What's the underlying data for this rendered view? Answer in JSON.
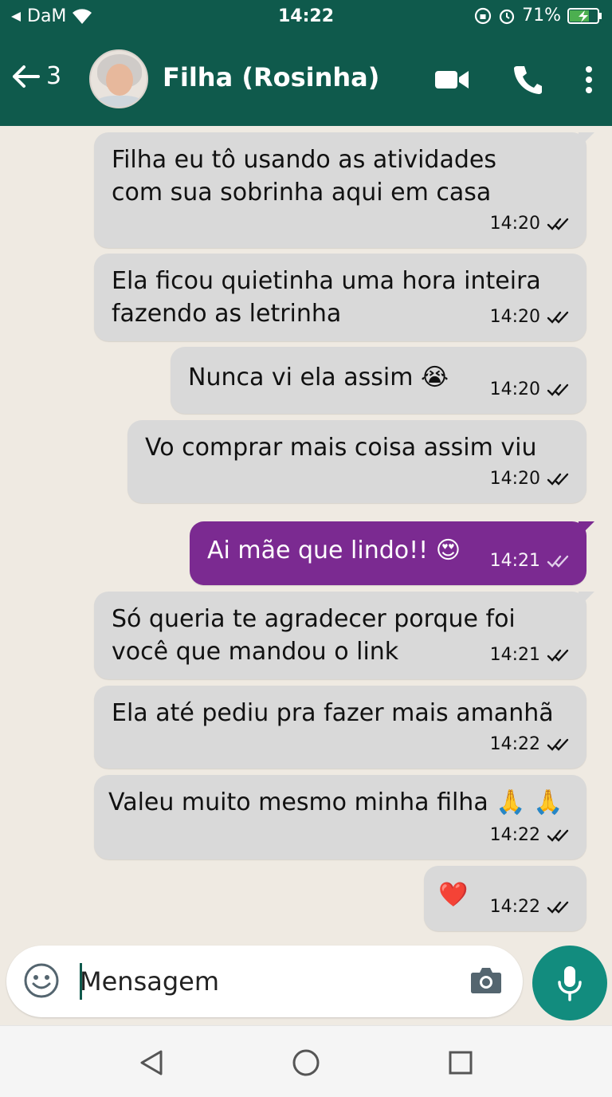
{
  "status_bar": {
    "carrier": "DaM",
    "time": "14:22",
    "battery": "71%"
  },
  "header": {
    "unread_count": "3",
    "contact_name": "Filha (Rosinha)"
  },
  "messages": [
    {
      "direction": "received",
      "text": "Filha eu tô usando as atividades\ncom sua sobrinha aqui em casa",
      "time": "14:20",
      "status": "read"
    },
    {
      "direction": "received",
      "text": "Ela ficou quietinha uma hora inteira\nfazendo as letrinha",
      "time": "14:20",
      "status": "read"
    },
    {
      "direction": "received",
      "text": "Nunca vi ela assim 😭",
      "time": "14:20",
      "status": "read"
    },
    {
      "direction": "received",
      "text": "Vo comprar mais coisa assim viu",
      "time": "14:20",
      "status": "read"
    },
    {
      "direction": "sent",
      "text": "Ai mãe que lindo!! 😍",
      "time": "14:21",
      "status": "delivered"
    },
    {
      "direction": "received",
      "text": "Só queria te agradecer porque foi\nvocê que mandou o link",
      "time": "14:21",
      "status": "read"
    },
    {
      "direction": "received",
      "text": "Ela até pediu pra fazer mais amanhã",
      "time": "14:22",
      "status": "read"
    },
    {
      "direction": "received",
      "text": "Valeu muito mesmo minha filha 🙏 🙏",
      "time": "14:22",
      "status": "read"
    },
    {
      "direction": "received",
      "text": "❤️",
      "time": "14:22",
      "status": "read"
    }
  ],
  "composer": {
    "placeholder": "Mensagem"
  },
  "colors": {
    "header": "#0f5a4c",
    "received_bubble": "#d9d9d9",
    "sent_bubble": "#7b2a91",
    "mic_button": "#128c7e"
  }
}
